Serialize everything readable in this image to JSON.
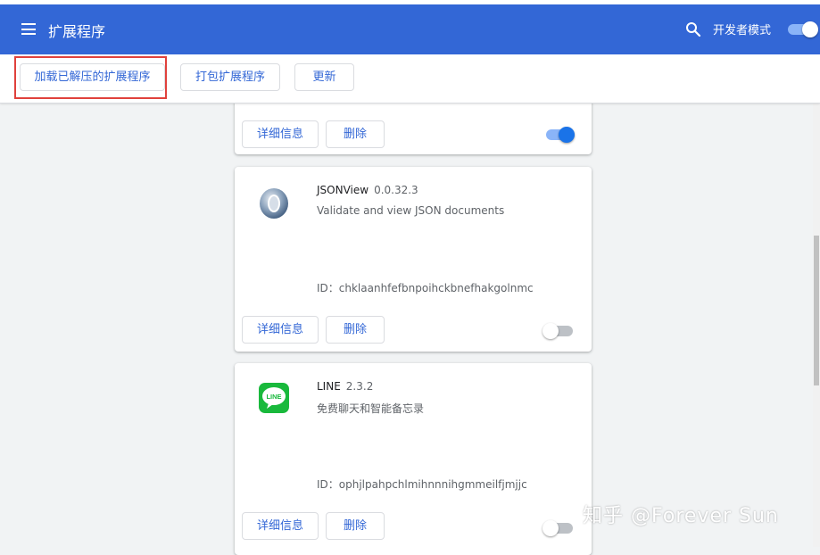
{
  "header": {
    "title": "扩展程序",
    "dev_mode_label": "开发者模式",
    "dev_mode_on": true,
    "accent": "#3367d6"
  },
  "toolbar": {
    "load_unpacked_label": "加载已解压的扩展程序",
    "pack_label": "打包扩展程序",
    "update_label": "更新"
  },
  "cards": [
    {
      "details_label": "详细信息",
      "remove_label": "删除",
      "enabled": true
    },
    {
      "name": "JSONView",
      "version": "0.0.32.3",
      "description": "Validate and view JSON documents",
      "id_text": "ID：chklaanhfefbnpoihckbnefhakgolnmc",
      "icon": "jsonview-icon",
      "details_label": "详细信息",
      "remove_label": "删除",
      "enabled": false
    },
    {
      "name": "LINE",
      "version": "2.3.2",
      "description": "免费聊天和智能备忘录",
      "icon_text": "LINE",
      "id_text": "ID：ophjlpahpchlmihnnnihgmmeilfjmjjc",
      "icon": "line-icon",
      "details_label": "详细信息",
      "remove_label": "删除",
      "enabled": false
    }
  ],
  "watermark": "知乎 @Forever Sun"
}
